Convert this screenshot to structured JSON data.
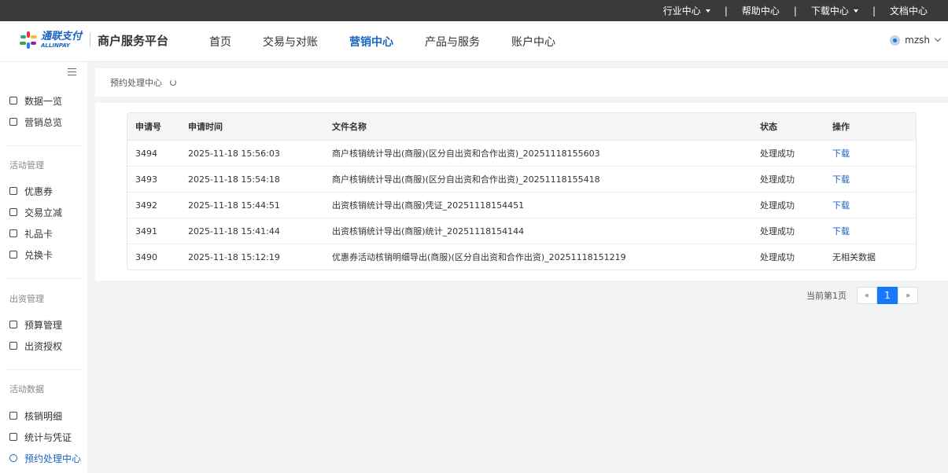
{
  "topbar": {
    "items": [
      {
        "label": "行业中心",
        "has_caret": true
      },
      {
        "label": "帮助中心",
        "has_caret": false
      },
      {
        "label": "下载中心",
        "has_caret": true
      },
      {
        "label": "文档中心",
        "has_caret": false
      }
    ],
    "separator": "|"
  },
  "header": {
    "logo_cn": "通联支付",
    "logo_en": "ALLINPAY",
    "platform_title": "商户服务平台",
    "nav": [
      {
        "label": "首页",
        "active": false
      },
      {
        "label": "交易与对账",
        "active": false
      },
      {
        "label": "营销中心",
        "active": true
      },
      {
        "label": "产品与服务",
        "active": false
      },
      {
        "label": "账户中心",
        "active": false
      }
    ],
    "user": {
      "name": "mzsh"
    }
  },
  "sidebar": {
    "top_items": [
      {
        "label": "数据一览",
        "icon": "chart-icon"
      },
      {
        "label": "营销总览",
        "icon": "chart-icon"
      }
    ],
    "groups": [
      {
        "title": "活动管理",
        "items": [
          {
            "label": "优惠券",
            "icon": "coupon-icon"
          },
          {
            "label": "交易立减",
            "icon": "discount-icon"
          },
          {
            "label": "礼品卡",
            "icon": "gift-card-icon"
          },
          {
            "label": "兑换卡",
            "icon": "exchange-card-icon"
          }
        ]
      },
      {
        "title": "出资管理",
        "items": [
          {
            "label": "预算管理",
            "icon": "budget-icon"
          },
          {
            "label": "出资授权",
            "icon": "authorize-icon"
          }
        ]
      },
      {
        "title": "活动数据",
        "items": [
          {
            "label": "核销明细",
            "icon": "detail-icon"
          },
          {
            "label": "统计与凭证",
            "icon": "stats-icon"
          },
          {
            "label": "预约处理中心",
            "icon": "process-center-icon",
            "active": true
          }
        ]
      }
    ]
  },
  "breadcrumb": {
    "title": "预约处理中心"
  },
  "table": {
    "headers": [
      "申请号",
      "申请时间",
      "文件名称",
      "状态",
      "操作"
    ],
    "rows": [
      {
        "id": "3494",
        "time": "2025-11-18 15:56:03",
        "file": "商户核销统计导出(商服)(区分自出资和合作出资)_20251118155603",
        "status": "处理成功",
        "action": "下载",
        "action_link": true
      },
      {
        "id": "3493",
        "time": "2025-11-18 15:54:18",
        "file": "商户核销统计导出(商服)(区分自出资和合作出资)_20251118155418",
        "status": "处理成功",
        "action": "下载",
        "action_link": true
      },
      {
        "id": "3492",
        "time": "2025-11-18 15:44:51",
        "file": "出资核销统计导出(商服)凭证_20251118154451",
        "status": "处理成功",
        "action": "下载",
        "action_link": true
      },
      {
        "id": "3491",
        "time": "2025-11-18 15:41:44",
        "file": "出资核销统计导出(商服)统计_20251118154144",
        "status": "处理成功",
        "action": "下载",
        "action_link": true
      },
      {
        "id": "3490",
        "time": "2025-11-18 15:12:19",
        "file": "优惠券活动核销明细导出(商服)(区分自出资和合作出资)_20251118151219",
        "status": "处理成功",
        "action": "无相关数据",
        "action_link": false
      }
    ]
  },
  "pagination": {
    "label": "当前第1页",
    "prev": "«",
    "current": "1",
    "next": "»"
  },
  "colors": {
    "accent": "#1a63c2",
    "pager_active": "#1677ff",
    "topbar": "#3a3a3a"
  }
}
